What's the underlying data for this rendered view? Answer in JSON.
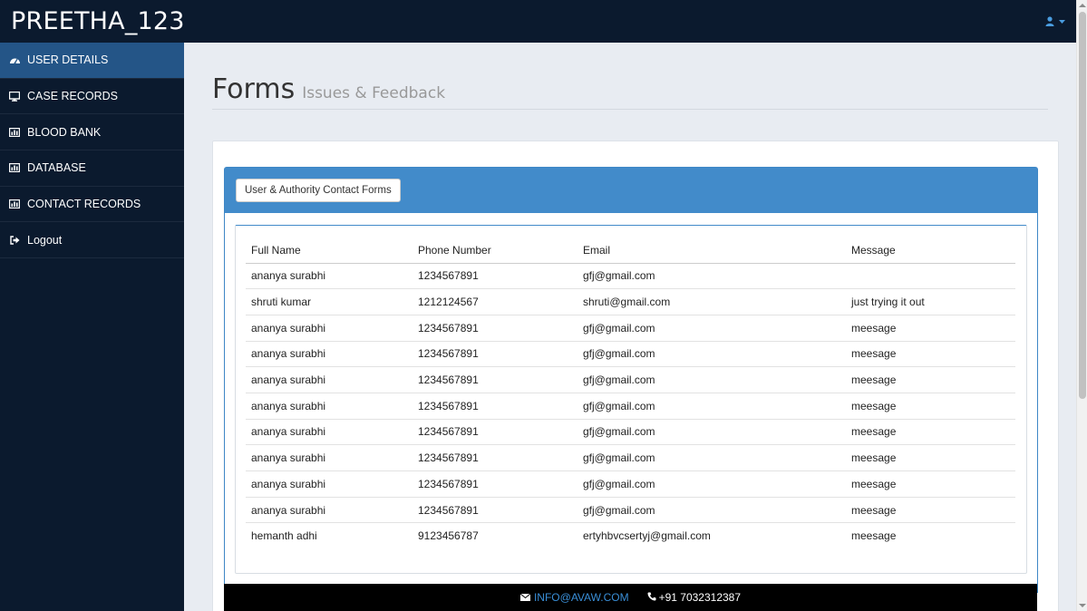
{
  "brand": "PREETHA_123",
  "user_menu": {
    "icon": "user-icon",
    "caret": "caret-down-icon"
  },
  "sidebar": {
    "items": [
      {
        "label": "USER DETAILS",
        "icon": "dashboard-icon",
        "active": true
      },
      {
        "label": "CASE RECORDS",
        "icon": "desktop-icon"
      },
      {
        "label": "BLOOD BANK",
        "icon": "bar-chart-icon"
      },
      {
        "label": "DATABASE",
        "icon": "bar-chart-icon"
      },
      {
        "label": "CONTACT RECORDS",
        "icon": "bar-chart-icon"
      },
      {
        "label": "Logout",
        "icon": "sign-out-icon"
      }
    ]
  },
  "page": {
    "title": "Forms",
    "subtitle": "Issues & Feedback"
  },
  "panel": {
    "button_label": "User & Authority Contact Forms"
  },
  "table": {
    "headers": [
      "Full Name",
      "Phone Number",
      "Email",
      "Message"
    ],
    "rows": [
      [
        "ananya surabhi",
        "1234567891",
        "gfj@gmail.com",
        ""
      ],
      [
        "shruti kumar",
        "1212124567",
        "shruti@gmail.com",
        "just trying it out"
      ],
      [
        "ananya surabhi",
        "1234567891",
        "gfj@gmail.com",
        "meesage"
      ],
      [
        "ananya surabhi",
        "1234567891",
        "gfj@gmail.com",
        "meesage"
      ],
      [
        "ananya surabhi",
        "1234567891",
        "gfj@gmail.com",
        "meesage"
      ],
      [
        "ananya surabhi",
        "1234567891",
        "gfj@gmail.com",
        "meesage"
      ],
      [
        "ananya surabhi",
        "1234567891",
        "gfj@gmail.com",
        "meesage"
      ],
      [
        "ananya surabhi",
        "1234567891",
        "gfj@gmail.com",
        "meesage"
      ],
      [
        "ananya surabhi",
        "1234567891",
        "gfj@gmail.com",
        "meesage"
      ],
      [
        "ananya surabhi",
        "1234567891",
        "gfj@gmail.com",
        "meesage"
      ],
      [
        "hemanth adhi",
        "9123456787",
        "ertyhbvcsertyj@gmail.com",
        "meesage"
      ]
    ]
  },
  "footer": {
    "email": "INFO@AVAW.COM",
    "phone": "+91 7032312387"
  },
  "colors": {
    "navbar": "#0b1a2e",
    "sidebar_active": "#245587",
    "panel_header": "#428bca",
    "link": "#3a8fd8"
  }
}
